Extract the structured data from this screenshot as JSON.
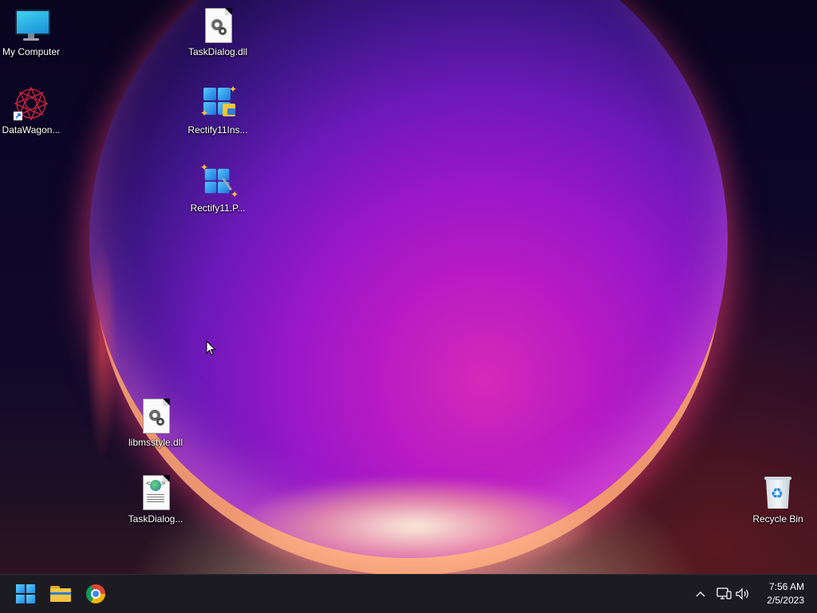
{
  "desktop": {
    "icons": {
      "my_computer": "My Computer",
      "taskdialog_dll": "TaskDialog.dll",
      "datawagon": "DataWagon...",
      "rectify_installer": "Rectify11Ins...",
      "rectify_patcher": "Rectify11.P...",
      "libmsstyle_dll": "libmsstyle.dll",
      "taskdialog_html": "TaskDialog...",
      "recycle_bin": "Recycle Bin"
    }
  },
  "taskbar": {
    "pinned": [
      "start-icon",
      "file-explorer-icon",
      "chrome-icon"
    ],
    "tray_icons": [
      "chevron-up-icon",
      "network-icon",
      "volume-icon"
    ],
    "clock": {
      "time": "7:56 AM",
      "date": "2/5/2023"
    }
  },
  "colors": {
    "taskbar_bg": "#1d1b22",
    "accent": "#1a8be8"
  }
}
